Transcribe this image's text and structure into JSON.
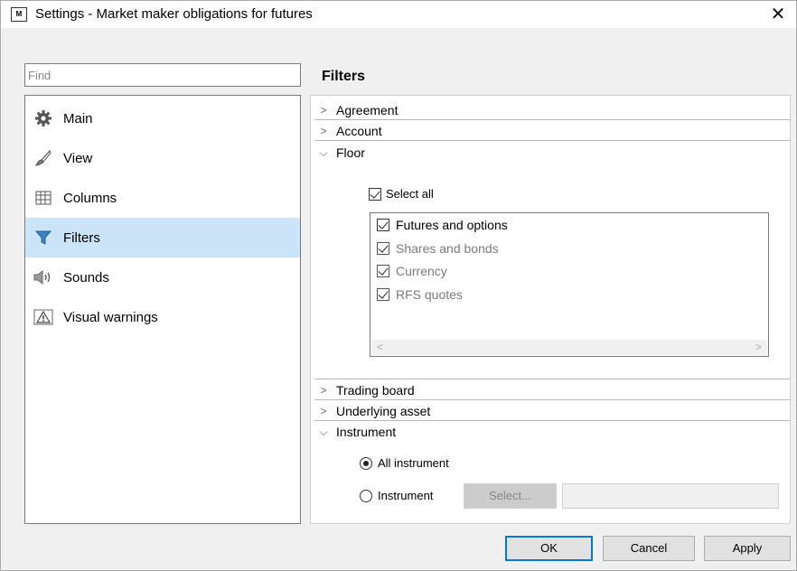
{
  "window": {
    "title": "Settings - Market maker obligations for futures",
    "app_icon_text": "M"
  },
  "search": {
    "placeholder": "Find",
    "value": ""
  },
  "nav": {
    "items": [
      {
        "label": "Main",
        "icon": "gear-icon"
      },
      {
        "label": "View",
        "icon": "brush-icon"
      },
      {
        "label": "Columns",
        "icon": "table-icon"
      },
      {
        "label": "Filters",
        "icon": "funnel-icon",
        "selected": true
      },
      {
        "label": "Sounds",
        "icon": "speaker-icon"
      },
      {
        "label": "Visual warnings",
        "icon": "warning-icon"
      }
    ]
  },
  "main": {
    "title": "Filters",
    "groups": {
      "agreement": "Agreement",
      "account": "Account",
      "floor": "Floor",
      "trading_board": "Trading board",
      "underlying_asset": "Underlying asset",
      "instrument": "Instrument"
    },
    "floor": {
      "select_all_label": "Select all",
      "items": [
        {
          "label": "Futures and options",
          "checked": true,
          "enabled": true
        },
        {
          "label": "Shares and bonds",
          "checked": true,
          "enabled": false
        },
        {
          "label": "Currency",
          "checked": true,
          "enabled": false
        },
        {
          "label": "RFS quotes",
          "checked": true,
          "enabled": false
        }
      ]
    },
    "instrument": {
      "all_label": "All instrument",
      "instrument_label": "Instrument",
      "select_button": "Select...",
      "selected_option": "All instrument"
    }
  },
  "footer": {
    "ok": "OK",
    "cancel": "Cancel",
    "apply": "Apply"
  },
  "colors": {
    "selection": "#cce4f7",
    "accent": "#0078d7"
  }
}
